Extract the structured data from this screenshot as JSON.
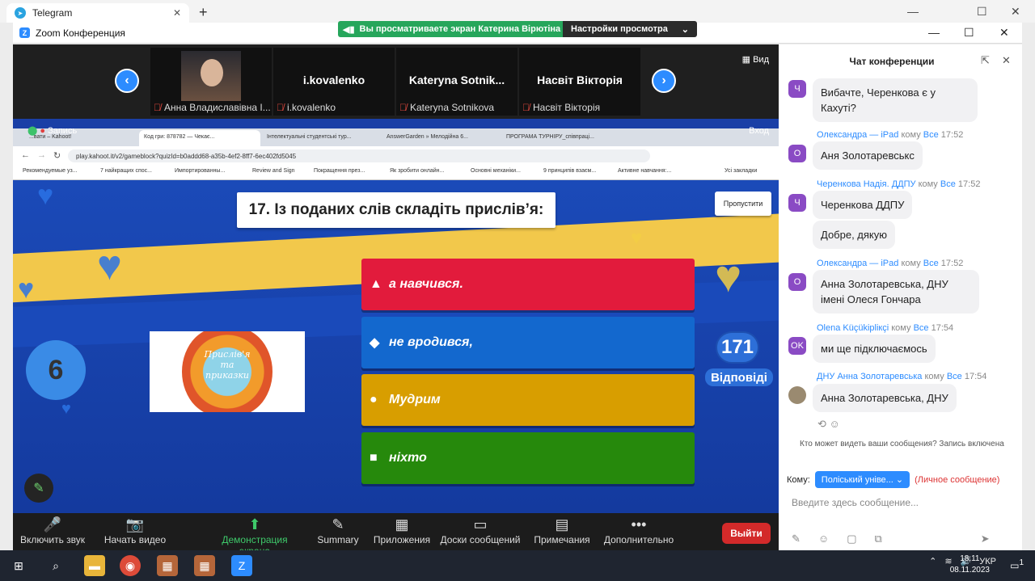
{
  "telegram": {
    "tab_title": "Telegram",
    "close": "✕",
    "new_tab": "+",
    "minimize": "—",
    "maximize": "☐",
    "close_window": "✕"
  },
  "zoom": {
    "window_title": "Zoom Конференция",
    "share_banner": "Вы просматриваете экран Катерина Вірютіна",
    "view_settings": "Настройки просмотра",
    "minimize": "—",
    "maximize": "☐",
    "close": "✕"
  },
  "gallery": {
    "view_label": "Вид",
    "tiles": [
      {
        "name": "",
        "label": "Анна Владиславівна І..."
      },
      {
        "name": "i.kovalenko",
        "label": "i.kovalenko"
      },
      {
        "name": "Kateryna  Sotnik...",
        "label": "Kateryna Sotnikova"
      },
      {
        "name": "Насвіт Вікторія",
        "label": "Насвіт Вікторія"
      }
    ]
  },
  "browser": {
    "record": "Запись",
    "enter": "Вход",
    "tabs": [
      "...вати – Kahoot!",
      "Код гри: 878782 — Чекає...",
      "Інтелектуальні студентські тур...",
      "AnswerGarden » Мелодійна 6...",
      "ПРОГРАМА ТУРНІРУ_співпраці..."
    ],
    "url": "play.kahoot.it/v2/gameblock?quizId=b0addd68-a35b-4ef2-8ff7-6ec402fd5045",
    "bookmarks": [
      "Рекомендуемые уз...",
      "7 найкращих спос...",
      "Импортированны...",
      "Review and Sign",
      "Покращення през...",
      "Як зробити онлайн...",
      "Основні механіки...",
      "9 принципів взаєм...",
      "Активне навчання:...",
      "Усі закладки"
    ]
  },
  "kahoot": {
    "question": "17. Із поданих слів складіть прислів’я:",
    "skip": "Пропустити",
    "timer": "6",
    "image_caption": "Прислів'я та приказки",
    "answers": [
      {
        "symbol": "▲",
        "text": "а навчився.",
        "color": "#e21b3c"
      },
      {
        "symbol": "◆",
        "text": "не вродився,",
        "color": "#1368ce"
      },
      {
        "symbol": "●",
        "text": "Мудрим",
        "color": "#d89e00"
      },
      {
        "symbol": "■",
        "text": "ніхто",
        "color": "#26890c"
      }
    ],
    "answer_count": "171",
    "answer_count_label": "Відповіді"
  },
  "toolbar": {
    "items": [
      {
        "label": "Включить звук",
        "icon": "🎤"
      },
      {
        "label": "Начать видео",
        "icon": "📷"
      },
      {
        "label": "Демонстрация экрана",
        "icon": "⬆"
      },
      {
        "label": "Summary",
        "icon": "✎"
      },
      {
        "label": "Приложения",
        "icon": "▦"
      },
      {
        "label": "Доски сообщений",
        "icon": "▭"
      },
      {
        "label": "Примечания",
        "icon": "▤"
      },
      {
        "label": "Дополнительно",
        "icon": "•••"
      }
    ],
    "leave": "Выйти"
  },
  "chat": {
    "title": "Чат конференции",
    "messages": [
      {
        "avatar": "Ч",
        "sender": "",
        "to": "",
        "to_target": "",
        "time": "",
        "text": "Вибачте, Черенкова є у Кахуті?"
      },
      {
        "avatar": "О",
        "sender": "Олександра — iPad",
        "to": "кому",
        "to_target": "Все",
        "time": "17:52",
        "text": "Аня Золотаревськс"
      },
      {
        "avatar": "Ч",
        "sender": "Черенкова Надія. ДДПУ",
        "to": "кому",
        "to_target": "Все",
        "time": "17:52",
        "text": "Черенкова ДДПУ"
      },
      {
        "avatar": "",
        "sender": "",
        "to": "",
        "to_target": "",
        "time": "",
        "text": "Добре, дякую"
      },
      {
        "avatar": "О",
        "sender": "Олександра — iPad",
        "to": "кому",
        "to_target": "Все",
        "time": "17:52",
        "text": "Анна Золотаревська, ДНУ імені Олеся Гончара"
      },
      {
        "avatar": "OK",
        "sender": "Olena Küçükipliкçі",
        "to": "кому",
        "to_target": "Все",
        "time": "17:54",
        "text": "ми ще підключаємось"
      },
      {
        "avatar": "",
        "sender": "ДНУ Анна Золотаревська",
        "to": "кому",
        "to_target": "Все",
        "time": "17:54",
        "text": "Анна Золотаревська, ДНУ"
      }
    ],
    "notice": "Кто может видеть ваши сообщения? Запись включена",
    "to_label": "Кому:",
    "to_value": "Поліський уніве...",
    "private": "(Личное сообщение)",
    "input_placeholder": "Введите здесь сообщение..."
  },
  "taskbar": {
    "lang": "УКР",
    "time": "18:11",
    "date": "08.11.2023",
    "notifications": "1"
  }
}
